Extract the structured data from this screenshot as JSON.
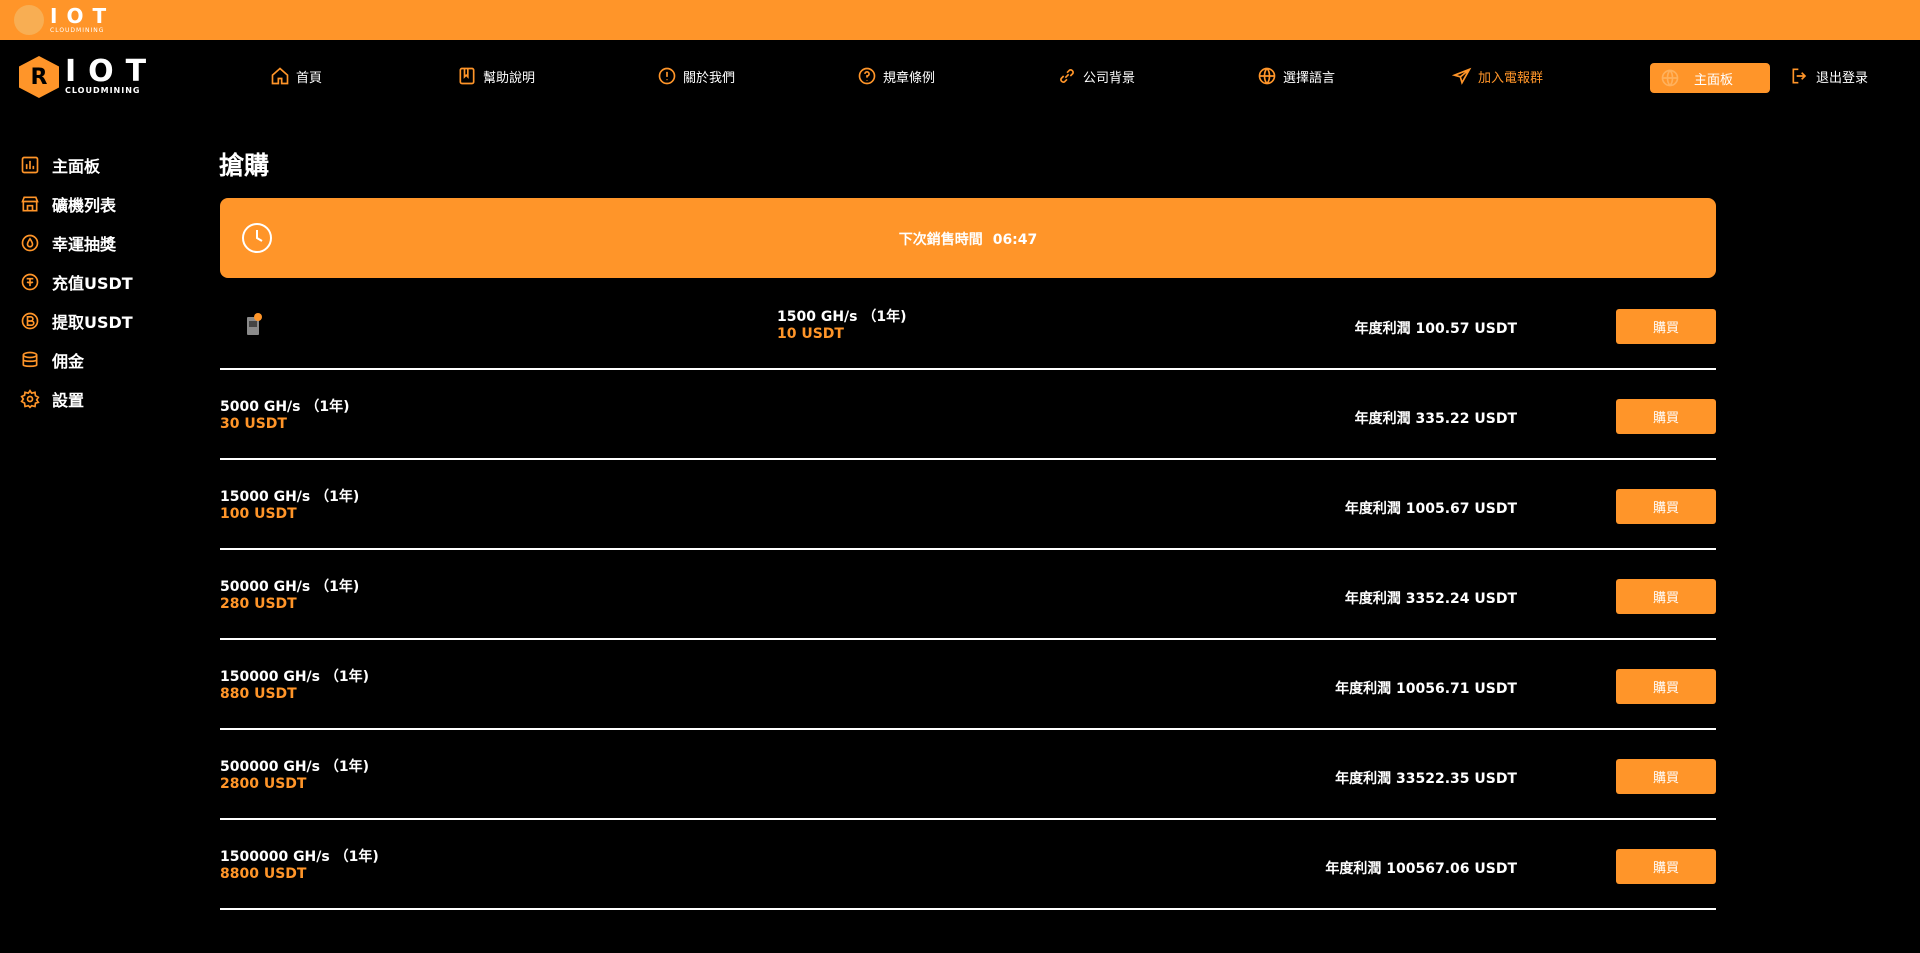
{
  "topbar": {
    "brand": "IOT",
    "brand_sub": "CLOUDMINING"
  },
  "logo": {
    "mark": "R",
    "title": "IOT",
    "sub": "CLOUDMINING"
  },
  "nav": [
    {
      "label": "首頁",
      "icon": "home-icon"
    },
    {
      "label": "幫助說明",
      "icon": "help-book-icon"
    },
    {
      "label": "關於我們",
      "icon": "info-circle-icon"
    },
    {
      "label": "規章條例",
      "icon": "question-circle-icon"
    },
    {
      "label": "公司背景",
      "icon": "link-icon"
    },
    {
      "label": "選擇語言",
      "icon": "globe-icon"
    },
    {
      "label": "加入電報群",
      "icon": "telegram-icon"
    }
  ],
  "nav_dashboard": "主面板",
  "nav_logout": "退出登录",
  "sidebar": [
    {
      "label": "主面板",
      "icon": "bar-chart-icon"
    },
    {
      "label": "礦機列表",
      "icon": "store-icon"
    },
    {
      "label": "幸運抽獎",
      "icon": "drop-icon"
    },
    {
      "label": "充值USDT",
      "icon": "usdt-icon"
    },
    {
      "label": "提取USDT",
      "icon": "bitcoin-icon"
    },
    {
      "label": "佣金",
      "icon": "database-icon"
    },
    {
      "label": "設置",
      "icon": "gear-icon"
    }
  ],
  "page_title": "搶購",
  "banner": {
    "label": "下次銷售時間",
    "time": "06:47"
  },
  "products": [
    {
      "hashrate": "1500 GH/s （1年)",
      "price": "10 USDT",
      "profit": "年度利潤 100.57 USDT",
      "buy": "購買"
    },
    {
      "hashrate": "5000 GH/s （1年)",
      "price": "30 USDT",
      "profit": "年度利潤 335.22 USDT",
      "buy": "購買"
    },
    {
      "hashrate": "15000 GH/s （1年)",
      "price": "100 USDT",
      "profit": "年度利潤 1005.67 USDT",
      "buy": "購買"
    },
    {
      "hashrate": "50000 GH/s （1年)",
      "price": "280 USDT",
      "profit": "年度利潤 3352.24 USDT",
      "buy": "購買"
    },
    {
      "hashrate": "150000 GH/s （1年)",
      "price": "880 USDT",
      "profit": "年度利潤 10056.71 USDT",
      "buy": "購買"
    },
    {
      "hashrate": "500000 GH/s （1年)",
      "price": "2800 USDT",
      "profit": "年度利潤 33522.35 USDT",
      "buy": "購買"
    },
    {
      "hashrate": "1500000 GH/s （1年)",
      "price": "8800 USDT",
      "profit": "年度利潤 100567.06 USDT",
      "buy": "購買"
    }
  ],
  "colors": {
    "accent": "#ff9529",
    "background": "#000000"
  }
}
